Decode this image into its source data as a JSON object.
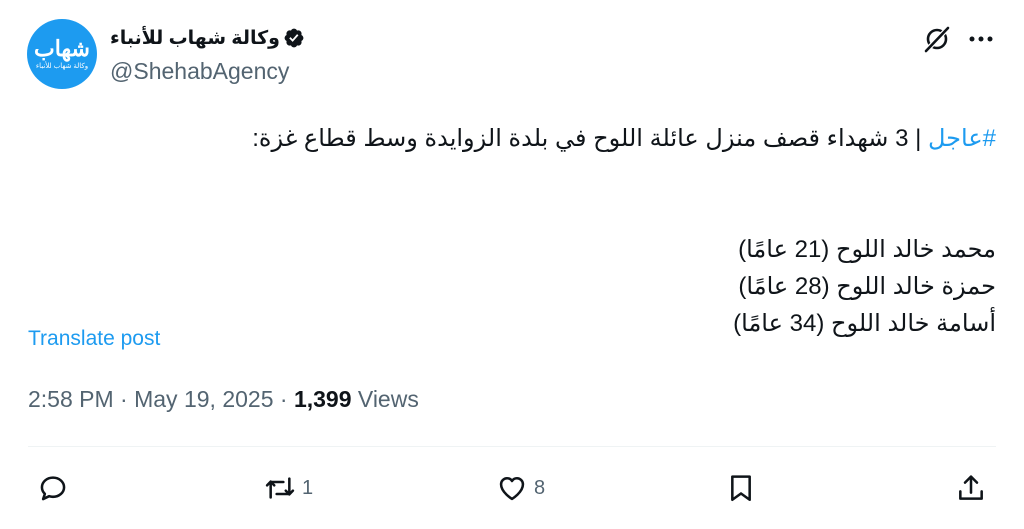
{
  "account": {
    "avatar_main_text": "شهاب",
    "avatar_sub_text": "وكالة شهاب للأنباء",
    "display_name": "وكالة شهاب للأنباء",
    "handle": "@ShehabAgency"
  },
  "post": {
    "hashtag": "#عاجل",
    "headline": " | 3 شهداء قصف منزل عائلة اللوح في بلدة الزوايدة وسط قطاع غزة:",
    "names": [
      "محمد خالد  اللوح (21 عامًا)",
      "حمزة خالد  اللوح (28 عامًا)",
      "أسامة خالد  اللوح (34 عامًا)"
    ],
    "translate_label": "Translate post"
  },
  "meta": {
    "time": "2:58 PM",
    "separator": " · ",
    "date": "May 19, 2025",
    "views_count": "1,399",
    "views_label": " Views"
  },
  "actions": {
    "reply_count": "",
    "repost_count": "1",
    "like_count": "8"
  },
  "icons": {
    "verified": "verified-badge-icon",
    "grok": "grok-icon",
    "more": "more-icon",
    "reply": "reply-icon",
    "repost": "repost-icon",
    "like": "heart-icon",
    "bookmark": "bookmark-icon",
    "share": "share-icon"
  },
  "colors": {
    "accent": "#1d9bf0",
    "text": "#0f1419",
    "secondary": "#536471"
  }
}
